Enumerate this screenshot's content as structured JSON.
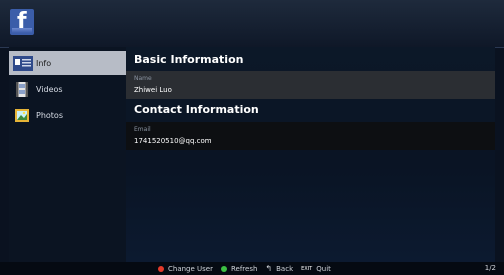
{
  "sidebar": {
    "items": [
      {
        "label": "Info",
        "active": true,
        "icon": "info-icon"
      },
      {
        "label": "Videos",
        "active": false,
        "icon": "video-icon"
      },
      {
        "label": "Photos",
        "active": false,
        "icon": "photo-icon"
      }
    ]
  },
  "main": {
    "basic_title": "Basic Information",
    "name_label": "Name",
    "name_value": "Zhiwei Luo",
    "contact_title": "Contact Information",
    "email_label": "Email",
    "email_value": "1741520510@qq.com"
  },
  "footer": {
    "change_user": "Change User",
    "refresh": "Refresh",
    "back": "Back",
    "exit_key": "EXIT",
    "quit": "Quit",
    "page": "1/2"
  },
  "colors": {
    "red_key": "#e53a2a",
    "green_key": "#3cc043",
    "facebook_blue": "#3b5da9"
  }
}
